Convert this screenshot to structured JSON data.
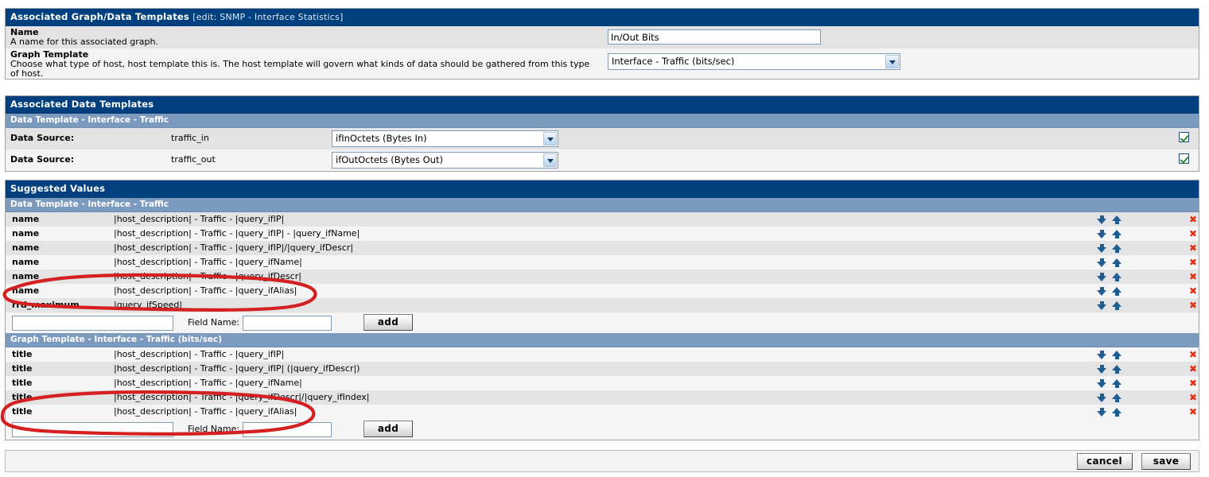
{
  "window": {
    "top_panel_title": "Associated Graph/Data Templates",
    "top_panel_subtitle": "[edit: SNMP - Interface Statistics]"
  },
  "graph_form": {
    "name_label": "Name",
    "name_desc": "A name for this associated graph.",
    "name_value": "In/Out Bits",
    "graph_template_label": "Graph Template",
    "graph_template_desc": "Choose what type of host, host template this is. The host template will govern what kinds of data should be gathered from this type of host.",
    "graph_template_value": "Interface - Traffic (bits/sec)"
  },
  "data_templates": {
    "panel_title": "Associated Data Templates",
    "subheader": "Data Template - Interface - Traffic",
    "rows": [
      {
        "label": "Data Source:",
        "name": "traffic_in",
        "select_value": "ifInOctets (Bytes In)",
        "checked": true
      },
      {
        "label": "Data Source:",
        "name": "traffic_out",
        "select_value": "ifOutOctets (Bytes Out)",
        "checked": true
      }
    ]
  },
  "suggested_values": {
    "panel_title": "Suggested Values",
    "sections": [
      {
        "subheader": "Data Template - Interface - Traffic",
        "rows": [
          {
            "field": "name",
            "value": "|host_description| - Traffic - |query_ifIP|"
          },
          {
            "field": "name",
            "value": "|host_description| - Traffic - |query_ifIP| - |query_ifName|"
          },
          {
            "field": "name",
            "value": "|host_description| - Traffic - |query_ifIP|/|query_ifDescr|"
          },
          {
            "field": "name",
            "value": "|host_description| - Traffic - |query_ifName|"
          },
          {
            "field": "name",
            "value": "|host_description| - Traffic - |query_ifDescr|"
          },
          {
            "field": "name",
            "value": "|host_description| - Traffic - |query_ifAlias|"
          },
          {
            "field": "rrd_maximum",
            "value": "|query_ifSpeed|"
          }
        ],
        "add_row": {
          "value_input": "",
          "field_name_label": "Field Name:",
          "field_name_input": "",
          "add_button": "add"
        }
      },
      {
        "subheader": "Graph Template - Interface - Traffic (bits/sec)",
        "rows": [
          {
            "field": "title",
            "value": "|host_description| - Traffic - |query_ifIP|"
          },
          {
            "field": "title",
            "value": "|host_description| - Traffic - |query_ifIP| (|query_ifDescr|)"
          },
          {
            "field": "title",
            "value": "|host_description| - Traffic - |query_ifName|"
          },
          {
            "field": "title",
            "value": "|host_description| - Traffic - |query_ifDescr|/|query_ifIndex|"
          },
          {
            "field": "title",
            "value": "|host_description| - Traffic - |query_ifAlias|"
          }
        ],
        "add_row": {
          "value_input": "",
          "field_name_label": "Field Name:",
          "field_name_input": "",
          "add_button": "add"
        }
      }
    ],
    "row_icons": {
      "move_down": "arrow-down-icon",
      "move_up": "arrow-up-icon",
      "delete": "delete-x-icon"
    },
    "delete_glyph": "✖"
  },
  "footer": {
    "cancel_label": "cancel",
    "save_label": "save"
  },
  "annotations": {
    "color": "#d42020",
    "marks": [
      {
        "name": "highlight-ifalias-name-row"
      },
      {
        "name": "highlight-ifalias-title-row"
      }
    ]
  }
}
